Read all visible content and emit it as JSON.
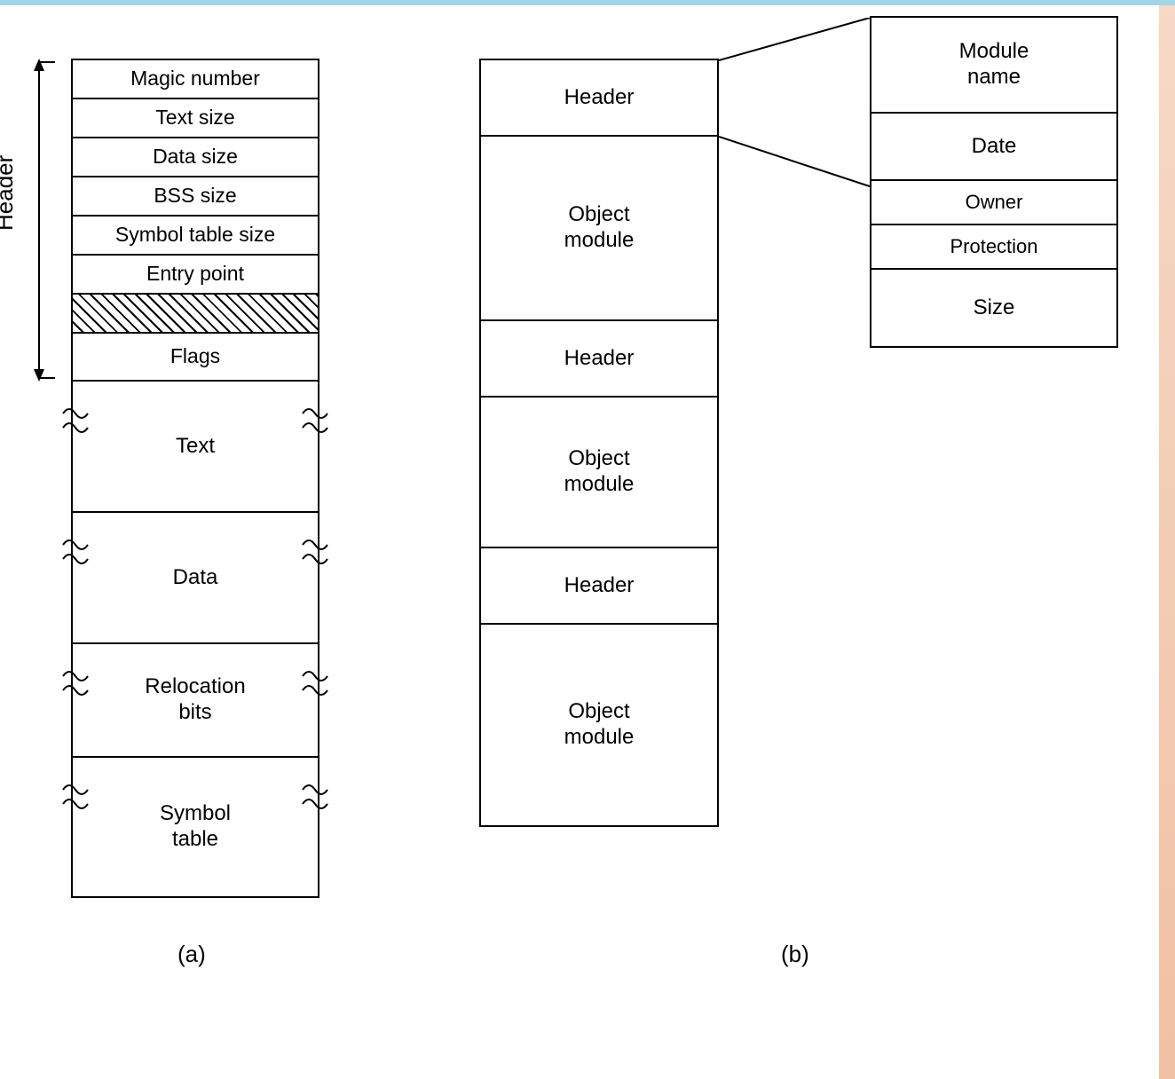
{
  "diagram_a": {
    "bracket_label": "Header",
    "header_fields": [
      "Magic number",
      "Text size",
      "Data size",
      "BSS size",
      "Symbol table size",
      "Entry point"
    ],
    "hatched_label": "",
    "flags_label": "Flags",
    "body_sections": [
      "Text",
      "Data",
      "Relocation\nbits",
      "Symbol\ntable"
    ],
    "caption": "(a)"
  },
  "diagram_b": {
    "modules": [
      {
        "header": "Header",
        "body": "Object\nmodule"
      },
      {
        "header": "Header",
        "body": "Object\nmodule"
      },
      {
        "header": "Header",
        "body": "Object\nmodule"
      }
    ],
    "detail_fields": [
      "Module\nname",
      "Date",
      "Owner",
      "Protection",
      "Size"
    ],
    "caption": "(b)"
  }
}
